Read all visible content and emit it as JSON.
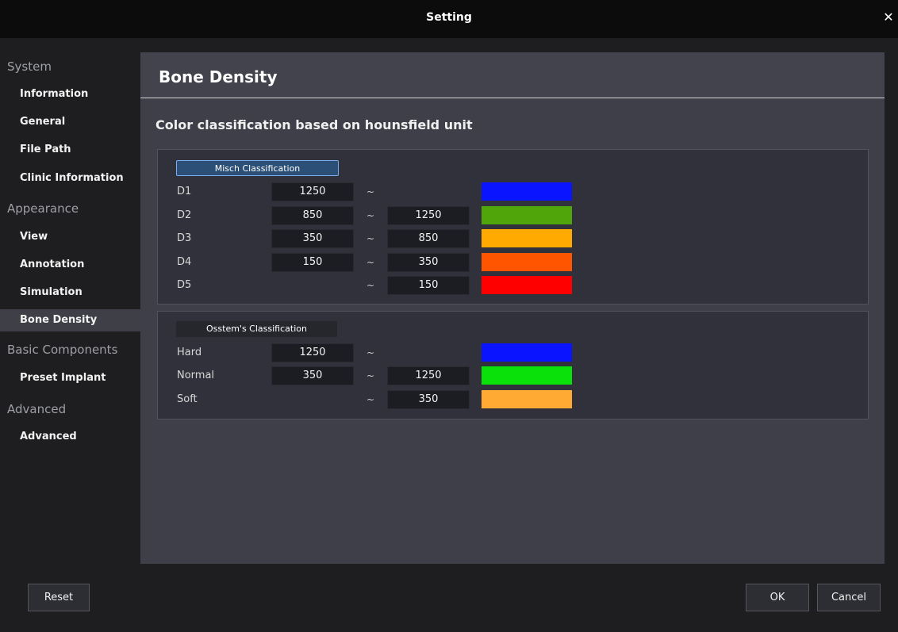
{
  "window": {
    "title": "Setting"
  },
  "sidebar": {
    "system": "System",
    "system_items": [
      "Information",
      "General",
      "File Path",
      "Clinic Information"
    ],
    "appearance": "Appearance",
    "appearance_items": [
      "View",
      "Annotation",
      "Simulation",
      "Bone Density"
    ],
    "basic": "Basic Components",
    "basic_items": [
      "Preset Implant"
    ],
    "advanced": "Advanced",
    "advanced_items": [
      "Advanced"
    ]
  },
  "panel": {
    "title": "Bone Density",
    "subtitle": "Color classification based on hounsfield unit"
  },
  "misch": {
    "label": "Misch Classification",
    "rows": [
      {
        "name": "D1",
        "low": "1250",
        "high": "",
        "color": "#0a14ff"
      },
      {
        "name": "D2",
        "low": "850",
        "high": "1250",
        "color": "#50a50a"
      },
      {
        "name": "D3",
        "low": "350",
        "high": "850",
        "color": "#ffaa00"
      },
      {
        "name": "D4",
        "low": "150",
        "high": "350",
        "color": "#ff5500"
      },
      {
        "name": "D5",
        "low": "",
        "high": "150",
        "color": "#ff0000"
      }
    ]
  },
  "osstem": {
    "label": "Osstem's Classification",
    "rows": [
      {
        "name": "Hard",
        "low": "1250",
        "high": "",
        "color": "#0a14ff"
      },
      {
        "name": "Normal",
        "low": "350",
        "high": "1250",
        "color": "#0ae00a"
      },
      {
        "name": "Soft",
        "low": "",
        "high": "350",
        "color": "#ffaa33"
      }
    ]
  },
  "tilde": "~",
  "buttons": {
    "reset": "Reset",
    "ok": "OK",
    "cancel": "Cancel"
  }
}
